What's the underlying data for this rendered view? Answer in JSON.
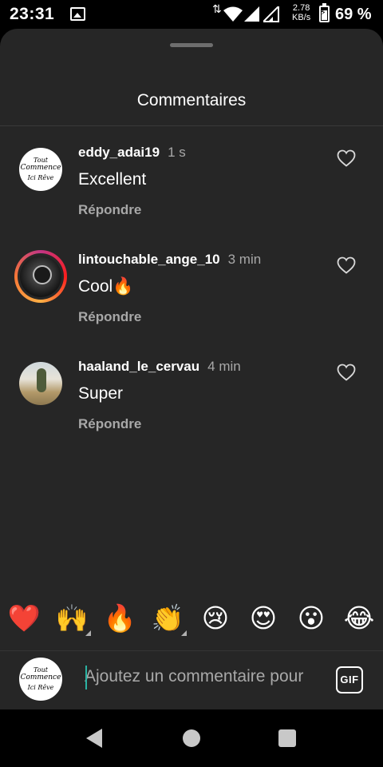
{
  "status_bar": {
    "time": "23:31",
    "speed_value": "2.78",
    "speed_unit": "KB/s",
    "battery_percent": "69 %",
    "battery_level": 0.69
  },
  "sheet": {
    "title": "Commentaires"
  },
  "comments": [
    {
      "username": "eddy_adai19",
      "time": "1 s",
      "text": "Excellent",
      "reply_label": "Répondre"
    },
    {
      "username": "lintouchable_ange_10",
      "time": "3 min",
      "text": "Cool🔥",
      "reply_label": "Répondre"
    },
    {
      "username": "haaland_le_cervau",
      "time": "4 min",
      "text": "Super",
      "reply_label": "Répondre"
    }
  ],
  "logo_text": {
    "line1": "Tout",
    "line2": "Commence",
    "line3": "Ici Rêve"
  },
  "emoji_reactions": [
    "❤️",
    "🙌",
    "🔥",
    "👏",
    "😢",
    "😍",
    "😮",
    "😂"
  ],
  "composer": {
    "placeholder": "Ajoutez un commentaire pour",
    "gif_label": "GIF"
  },
  "colors": {
    "sheet_background": "#262626",
    "secondary_text": "#a8a8a8",
    "caret": "#2bb3a3"
  }
}
